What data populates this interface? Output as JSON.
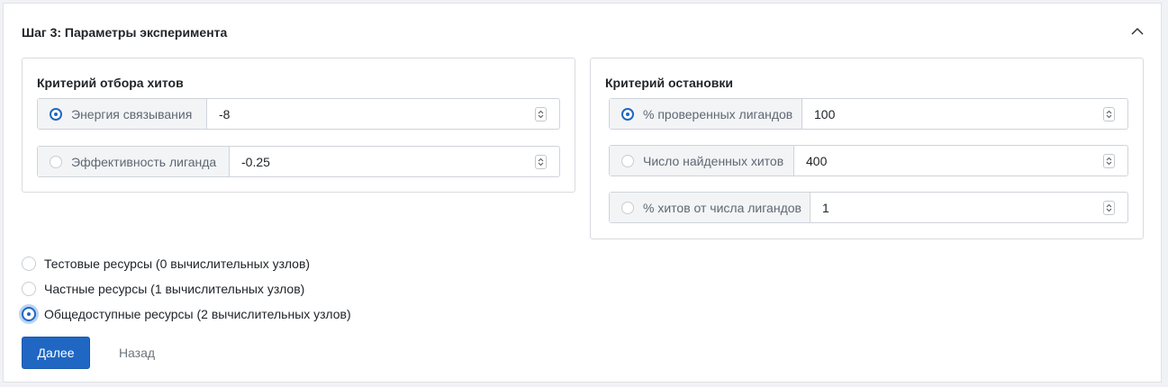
{
  "step": {
    "title": "Шаг 3: Параметры эксперимента"
  },
  "hit_criterion": {
    "title": "Критерий отбора хитов",
    "options": [
      {
        "label": "Энергия связывания",
        "value": "-8",
        "selected": true
      },
      {
        "label": "Эффективность лиганда",
        "value": "-0.25",
        "selected": false
      }
    ]
  },
  "stop_criterion": {
    "title": "Критерий остановки",
    "options": [
      {
        "label": "% проверенных лигандов",
        "value": "100",
        "selected": true
      },
      {
        "label": "Число найденных хитов",
        "value": "400",
        "selected": false
      },
      {
        "label": "% хитов от числа лигандов",
        "value": "1",
        "selected": false
      }
    ]
  },
  "resources": {
    "options": [
      {
        "label": "Тестовые ресурсы (0 вычислительных узлов)",
        "selected": false
      },
      {
        "label": "Частные ресурсы (1 вычислительных узлов)",
        "selected": false
      },
      {
        "label": "Общедоступные ресурсы (2 вычислительных узлов)",
        "selected": true
      }
    ]
  },
  "actions": {
    "next_label": "Далее",
    "back_label": "Назад"
  },
  "colors": {
    "accent": "#1f67c3",
    "label_bg": "#f3f4f6",
    "border": "#ced4da"
  }
}
